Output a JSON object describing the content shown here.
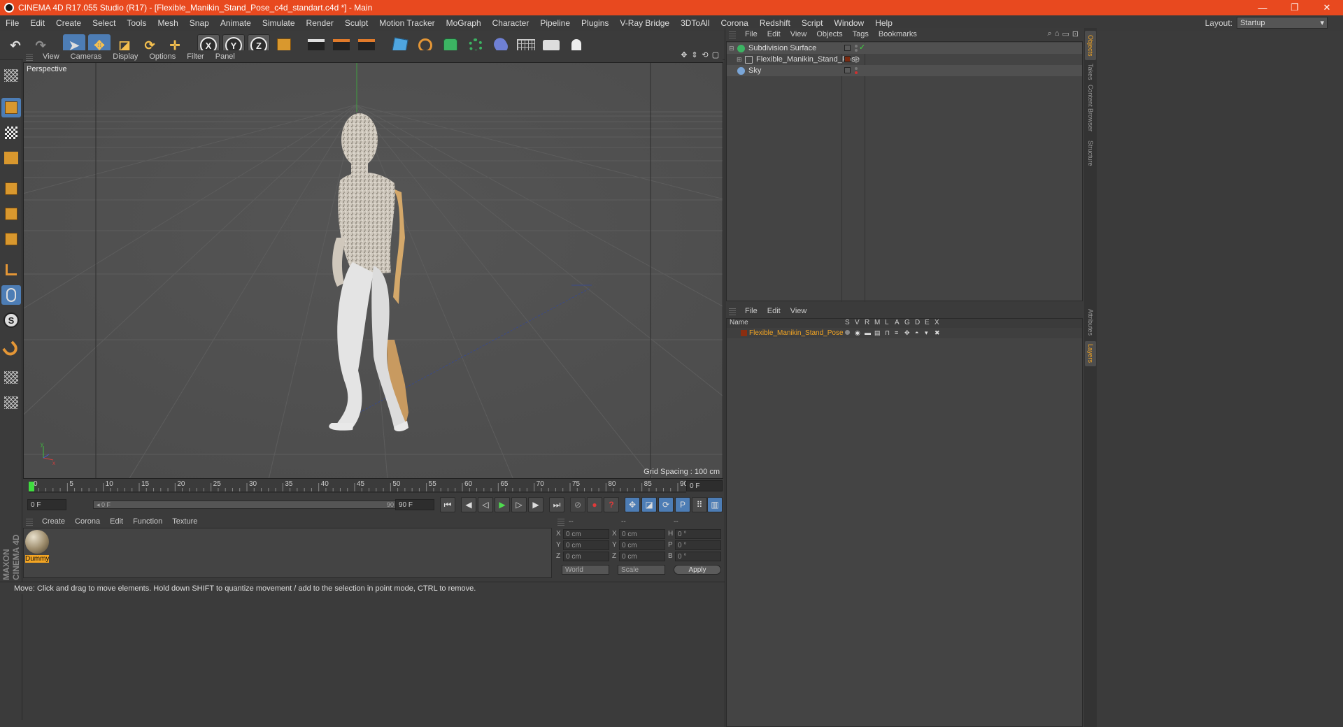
{
  "window": {
    "title": "CINEMA 4D R17.055 Studio (R17) - [Flexible_Manikin_Stand_Pose_c4d_standart.c4d *] - Main",
    "minimize": "—",
    "maximize": "❐",
    "close": "✕"
  },
  "menu": [
    "File",
    "Edit",
    "Create",
    "Select",
    "Tools",
    "Mesh",
    "Snap",
    "Animate",
    "Simulate",
    "Render",
    "Sculpt",
    "Motion Tracker",
    "MoGraph",
    "Character",
    "Pipeline",
    "Plugins",
    "V-Ray Bridge",
    "3DToAll",
    "Corona",
    "Redshift",
    "Script",
    "Window",
    "Help"
  ],
  "layout": {
    "label": "Layout:",
    "value": "Startup"
  },
  "toolbar": {
    "undo": "↶",
    "redo": "↷",
    "axis_x": "X",
    "axis_y": "Y",
    "axis_z": "Z"
  },
  "viewport": {
    "menu": [
      "View",
      "Cameras",
      "Display",
      "Options",
      "Filter",
      "Panel"
    ],
    "icons": [
      "✥",
      "⇕",
      "⟲",
      "▢"
    ],
    "label": "Perspective",
    "grid_spacing": "Grid Spacing : 100 cm"
  },
  "timeline": {
    "ticks": [
      "0",
      "5",
      "10",
      "15",
      "20",
      "25",
      "30",
      "35",
      "40",
      "45",
      "50",
      "55",
      "60",
      "65",
      "70",
      "75",
      "80",
      "85",
      "90"
    ],
    "end_field": "0 F",
    "current": "0 F",
    "slider_start": "◂ 0 F",
    "slider_end": "90 F ▸",
    "max": "90 F"
  },
  "transport": {
    "first": "⏮",
    "prev_key": "◀",
    "prev": "◁",
    "play": "▶",
    "next": "▷",
    "next_key": "▶",
    "last": "⏭",
    "record": "●",
    "help": "?",
    "p": "P"
  },
  "materials": {
    "menu": [
      "Create",
      "Corona",
      "Edit",
      "Function",
      "Texture"
    ],
    "items": [
      {
        "name": "Dummy"
      }
    ]
  },
  "coordinates": {
    "header": [
      "--",
      "--",
      "--"
    ],
    "rows": [
      {
        "pos_label": "X",
        "pos": "0 cm",
        "size_label": "X",
        "size": "0 cm",
        "rot_label": "H",
        "rot": "0 °"
      },
      {
        "pos_label": "Y",
        "pos": "0 cm",
        "size_label": "Y",
        "size": "0 cm",
        "rot_label": "P",
        "rot": "0 °"
      },
      {
        "pos_label": "Z",
        "pos": "0 cm",
        "size_label": "Z",
        "size": "0 cm",
        "rot_label": "B",
        "rot": "0 °"
      }
    ],
    "space": "World",
    "mode": "Scale",
    "apply": "Apply"
  },
  "status": "Move: Click and drag to move elements. Hold down SHIFT to quantize movement / add to the selection in point mode, CTRL to remove.",
  "branding": "MAXON CINEMA 4D",
  "object_manager": {
    "menu": [
      "File",
      "Edit",
      "View",
      "Objects",
      "Tags",
      "Bookmarks"
    ],
    "objects": [
      {
        "name": "Subdivision Surface",
        "color": "#3cb463"
      },
      {
        "name": "Flexible_Manikin_Stand_Pose",
        "color": "#bbbbbb"
      },
      {
        "name": "Sky",
        "color": "#7aa6d8"
      }
    ]
  },
  "layer_manager": {
    "menu": [
      "File",
      "Edit",
      "View"
    ],
    "columns": [
      "Name",
      "S",
      "V",
      "R",
      "M",
      "L",
      "A",
      "G",
      "D",
      "E",
      "X"
    ],
    "layers": [
      {
        "name": "Flexible_Manikin_Stand_Pose",
        "color": "#8b2e10"
      }
    ]
  },
  "side_tabs": [
    "Objects",
    "Takes",
    "Content Browser",
    "Structure",
    "Attributes",
    "Layers"
  ],
  "colors": {
    "accent": "#e8491f",
    "active": "#4d7db5",
    "highlight": "#f5a623"
  }
}
